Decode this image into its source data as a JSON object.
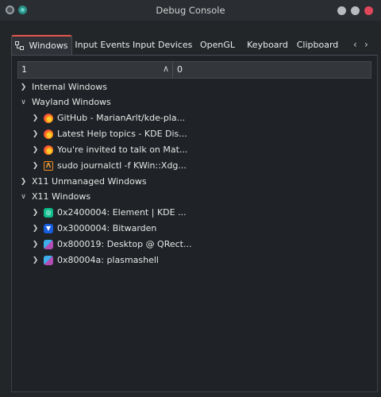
{
  "window": {
    "title": "Debug Console"
  },
  "tabs": [
    {
      "label": "Windows",
      "active": true
    },
    {
      "label": "Input Events"
    },
    {
      "label": "Input Devices"
    },
    {
      "label": "OpenGL"
    },
    {
      "label": "Keyboard"
    },
    {
      "label": "Clipboard"
    }
  ],
  "table": {
    "columns": [
      "1",
      "0"
    ]
  },
  "tree": [
    {
      "label": "Internal Windows",
      "expanded": false
    },
    {
      "label": "Wayland Windows",
      "expanded": true,
      "children": [
        {
          "label": "GitHub - MarianArlt/kde-pla...",
          "icon": "firefox-icon"
        },
        {
          "label": "Latest Help topics - KDE Dis...",
          "icon": "firefox-icon"
        },
        {
          "label": "You're invited to talk on Mat...",
          "icon": "firefox-icon"
        },
        {
          "label": "sudo journalctl -f KWin::Xdg...",
          "icon": "terminal-icon"
        }
      ]
    },
    {
      "label": "X11 Unmanaged Windows",
      "expanded": false
    },
    {
      "label": "X11 Windows",
      "expanded": true,
      "children": [
        {
          "label": "0x2400004: Element | KDE ...",
          "icon": "element-icon"
        },
        {
          "label": "0x3000004: Bitwarden",
          "icon": "bitwarden-icon"
        },
        {
          "label": "0x800019: Desktop @ QRect...",
          "icon": "desktop-icon"
        },
        {
          "label": "0x80004a: plasmashell",
          "icon": "plasma-icon"
        }
      ]
    }
  ]
}
